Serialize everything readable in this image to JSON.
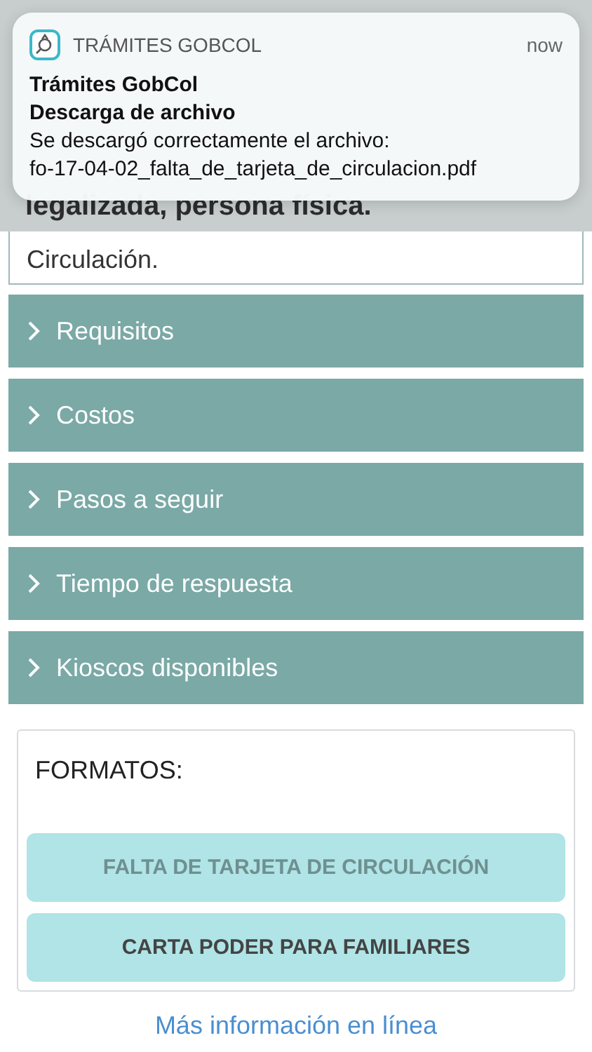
{
  "notification": {
    "app_name": "TRÁMITES GOBCOL",
    "time": "now",
    "title": "Trámites GobCol",
    "subtitle": "Descarga de archivo",
    "body_lines": [
      "Se descargó correctamente el archivo:",
      "fo-17-04-02_falta_de_tarjeta_de_circulacion.pdf"
    ]
  },
  "header": {
    "title": "legalizada, persona física."
  },
  "description": {
    "text": "Circulación."
  },
  "sections": [
    {
      "label": "Requisitos",
      "expanded": false
    },
    {
      "label": "Costos",
      "expanded": false
    },
    {
      "label": "Pasos a seguir",
      "expanded": false
    },
    {
      "label": "Tiempo de respuesta",
      "expanded": false
    },
    {
      "label": "Kioscos disponibles",
      "expanded": false
    }
  ],
  "formats": {
    "title": "FORMATOS:",
    "buttons": [
      {
        "label": "FALTA DE TARJETA DE CIRCULACIÓN",
        "disabled": true
      },
      {
        "label": "CARTA PODER PARA FAMILIARES",
        "disabled": false
      }
    ]
  },
  "link": "Más información en línea"
}
